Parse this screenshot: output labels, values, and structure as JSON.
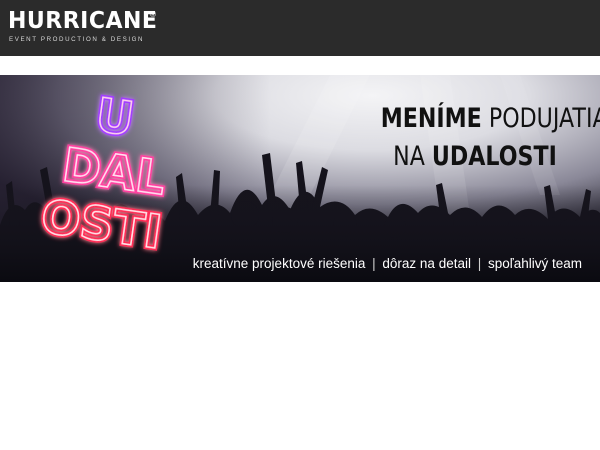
{
  "header": {
    "logo_text": "HURRICANE",
    "logo_mark": "®",
    "logo_tagline": "EVENT PRODUCTION & DESIGN",
    "background": "#2b2b2b"
  },
  "hero": {
    "neon_lines": [
      "U",
      "DAL",
      "OSTI"
    ],
    "slogan_line1_bold": "MENÍME",
    "slogan_line1_light": "PODUJATIA",
    "slogan_line2_light": "NA",
    "slogan_line2_bold": "UDALOSTI",
    "tagline_items": [
      "kreatívne projektové riešenia",
      "dôraz na detail",
      "spoľahlivý team"
    ],
    "separator": "|",
    "accent_colors": {
      "neon_pink": "#ff3fa0",
      "neon_purple": "#a23cff",
      "neon_red": "#ff2b55"
    }
  }
}
